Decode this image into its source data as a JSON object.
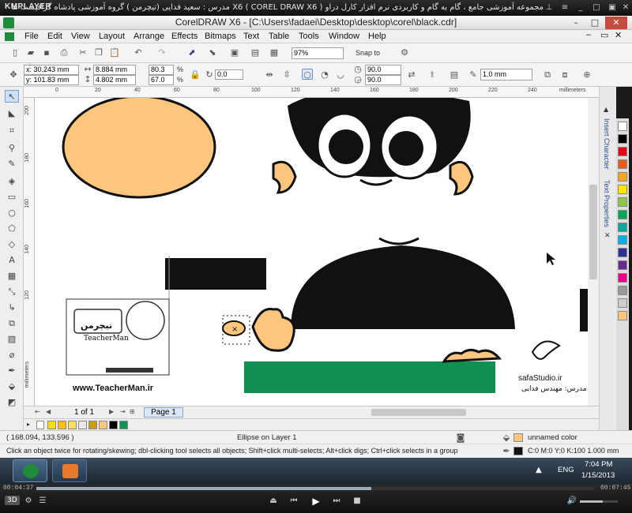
{
  "player": {
    "logo": "KMPLAYER",
    "caption": "مجموعه آموزشی جامع ، گام به گام و کاربردی نرم افزار کارل دراو X6 ( COREL DRAW X6 )  مدرس : سعید فدایی (تیچرمن ) گروه آموزشی پادشاه گرافیست ها",
    "time_elapsed": "00:04:37",
    "time_total": "00:07:45",
    "progress": 0.6,
    "mode_3d": "3D",
    "volume": 0.6
  },
  "window": {
    "title": "CorelDRAW X6 - [C:\\Users\\fadaei\\Desktop\\desktop\\corel\\black.cdr]"
  },
  "menu": [
    "File",
    "Edit",
    "View",
    "Layout",
    "Arrange",
    "Effects",
    "Bitmaps",
    "Text",
    "Table",
    "Tools",
    "Window",
    "Help"
  ],
  "toolbar": {
    "zoom": "97%",
    "snap": "Snap to"
  },
  "props": {
    "x": "x: 30.243 mm",
    "y": "y: 101.83 mm",
    "w": "8.884 mm",
    "h": "4.802 mm",
    "sx": "80.3",
    "sy": "67.0",
    "pct": "%",
    "rotation": "0.0",
    "angle1": "90.0",
    "angle2": "90.0",
    "outline": "1.0 mm"
  },
  "ruler": {
    "unit": "millimeters",
    "top_ticks": [
      "0",
      "20",
      "40",
      "60",
      "80",
      "100",
      "120",
      "140",
      "160",
      "180",
      "200",
      "220",
      "240",
      "260"
    ],
    "left_ticks": [
      "200",
      "180",
      "160",
      "140",
      "120"
    ]
  },
  "pages": {
    "counter": "1 of 1",
    "tab": "Page 1"
  },
  "docker_tabs": [
    "Insert Character",
    "Text Properties"
  ],
  "canvas": {
    "watermark_brand": "تیچرمن",
    "watermark_name": "TeacherMan",
    "watermark_url": "www.TeacherMan.ir",
    "studio_name": "safaStudio.ir",
    "studio_teacher": "مدرس: مهندس فدایی"
  },
  "status": {
    "coords": "( 168.094, 133.596 )",
    "object": "Ellipse on Layer 1",
    "fill_name": "unnamed color",
    "outline_info": "C:0 M:0 Y:0 K:100  1.000 mm",
    "hint": "Click an object twice for rotating/skewing; dbl-clicking tool selects all objects; Shift+click multi-selects; Alt+click digs; Ctrl+click selects in a group"
  },
  "taskbar": {
    "lang": "ENG",
    "time": "7:04 PM",
    "date": "1/15/2013"
  },
  "colors": {
    "skin": "#fcc67f",
    "green": "#119151",
    "black": "#111111"
  },
  "palette": [
    "#ffffff",
    "#000000",
    "#e30613",
    "#e85e19",
    "#f5a623",
    "#ffe600",
    "#8dc63f",
    "#00a651",
    "#00a99d",
    "#00aeef",
    "#2e3192",
    "#662d91",
    "#ec008c",
    "#999999",
    "#cccccc",
    "#fcc67f"
  ],
  "bottom_palette": [
    "#f7e000",
    "#fac000",
    "#ffdf5a",
    "#e8e8e8",
    "#c8a000",
    "#fcc67f",
    "#000000",
    "#119151"
  ]
}
